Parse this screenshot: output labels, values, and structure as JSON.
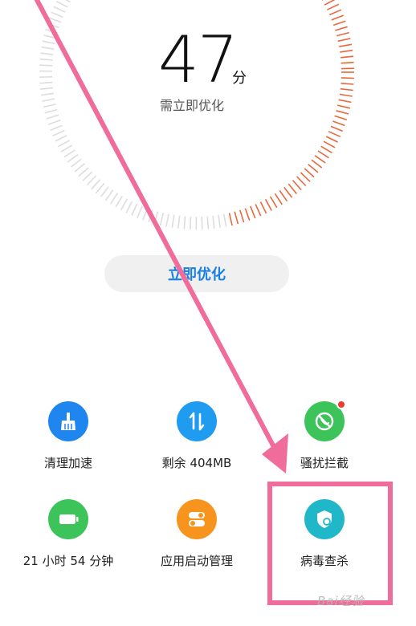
{
  "score": {
    "value": "47",
    "unit": "分",
    "status": "需立即优化",
    "level": 0.47
  },
  "actions": {
    "optimize_label": "立即优化"
  },
  "tools": [
    {
      "label": "清理加速",
      "icon": "broom-icon",
      "color": "#1f86f0"
    },
    {
      "label": "剩余 404MB",
      "icon": "swap-arrows-icon",
      "color": "#1f9cf0"
    },
    {
      "label": "骚扰拦截",
      "icon": "phone-block-icon",
      "color": "#3cc45a"
    },
    {
      "label": "21 小时 54 分钟",
      "icon": "battery-icon",
      "color": "#3cc45a"
    },
    {
      "label": "应用启动管理",
      "icon": "toggle-switches-icon",
      "color": "#f7941d"
    },
    {
      "label": "病毒查杀",
      "icon": "shield-search-icon",
      "color": "#20b8c8"
    }
  ],
  "colors": {
    "accent": "#1a7fe2",
    "gauge_tick": "#dddddd",
    "gauge_warning": "#e8683b",
    "annotation": "#f06c9b"
  },
  "watermark": {
    "text": "Bai经验"
  }
}
